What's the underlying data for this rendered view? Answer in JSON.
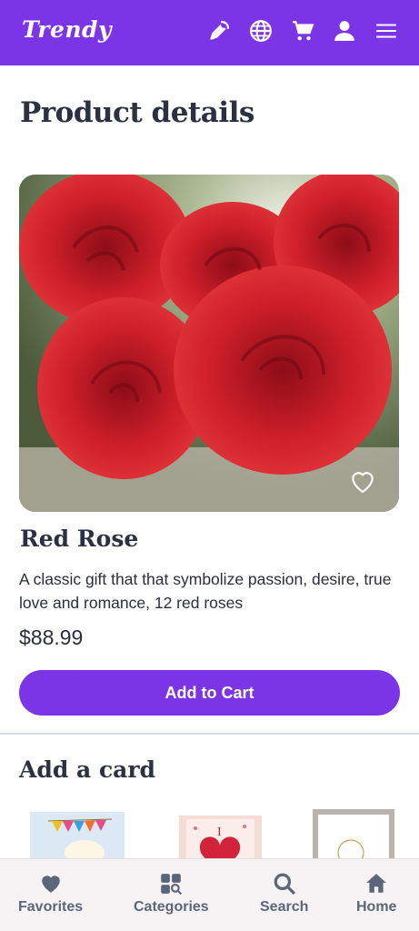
{
  "header": {
    "logo_text": "Trendy",
    "icons": [
      "promo-icon",
      "globe-icon",
      "cart-icon",
      "user-icon",
      "menu-icon"
    ],
    "background": "#7b35e6"
  },
  "main": {
    "page_title": "Product details",
    "product": {
      "name": "Red Rose",
      "description": "A classic gift that that symbolize passion, desire, true love and romance, 12 red roses",
      "price": "$88.99",
      "favorite_icon": "heart-outline-icon"
    },
    "add_to_cart_label": "Add to Cart",
    "add_card_title": "Add a card",
    "cards": [
      {
        "name": "birthday-card"
      },
      {
        "name": "love-card"
      },
      {
        "name": "framed-card"
      }
    ]
  },
  "bottom_nav": {
    "items": [
      {
        "label": "Favorites",
        "icon": "heart-icon"
      },
      {
        "label": "Categories",
        "icon": "categories-icon"
      },
      {
        "label": "Search",
        "icon": "search-icon"
      },
      {
        "label": "Home",
        "icon": "home-icon"
      }
    ]
  },
  "colors": {
    "accent": "#7b35e6",
    "text": "#2b3140",
    "nav_text": "#5b6779"
  }
}
